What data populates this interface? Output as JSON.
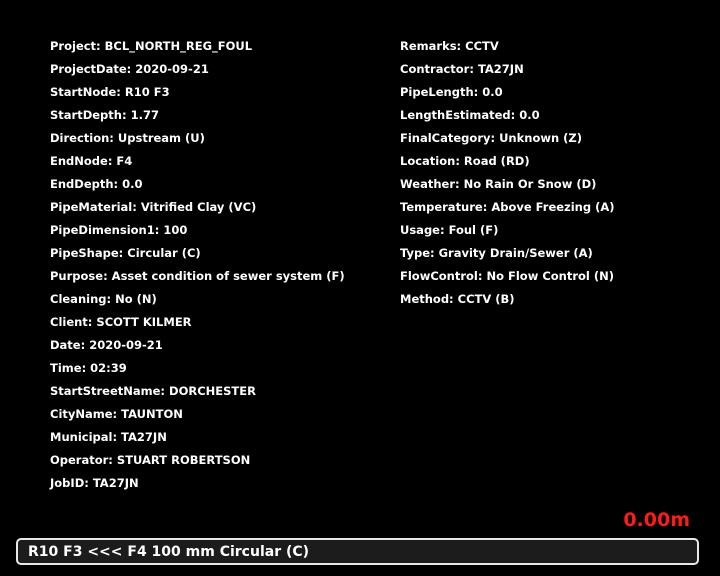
{
  "left_fields": [
    "Project: BCL_NORTH_REG_FOUL",
    "ProjectDate: 2020-09-21",
    "StartNode: R10 F3",
    "StartDepth: 1.77",
    "Direction: Upstream (U)",
    "EndNode: F4",
    "EndDepth: 0.0",
    "PipeMaterial: Vitrified Clay (VC)",
    "PipeDimension1: 100",
    "PipeShape: Circular (C)",
    "Purpose: Asset condition of sewer system (F)",
    "Cleaning: No (N)",
    "Client: SCOTT KILMER",
    "Date: 2020-09-21",
    "Time: 02:39",
    "StartStreetName: DORCHESTER",
    "CityName: TAUNTON",
    "Municipal: TA27JN",
    "Operator: STUART ROBERTSON",
    "JobID: TA27JN"
  ],
  "right_fields": [
    "Remarks: CCTV",
    "Contractor: TA27JN",
    "PipeLength: 0.0",
    "LengthEstimated: 0.0",
    "FinalCategory: Unknown (Z)",
    "Location: Road (RD)",
    "Weather: No Rain Or Snow (D)",
    "Temperature: Above Freezing (A)",
    "Usage: Foul (F)",
    "Type: Gravity Drain/Sewer (A)",
    "FlowControl: No Flow Control (N)",
    "Method: CCTV (B)"
  ],
  "distance_readout": "0.00m",
  "status_bar_text": "R10 F3 <<< F4 100 mm Circular (C)",
  "colors": {
    "background": "#000000",
    "text": "#ffffff",
    "distance": "#ff1a1a",
    "status_border": "#e8e8e8"
  }
}
